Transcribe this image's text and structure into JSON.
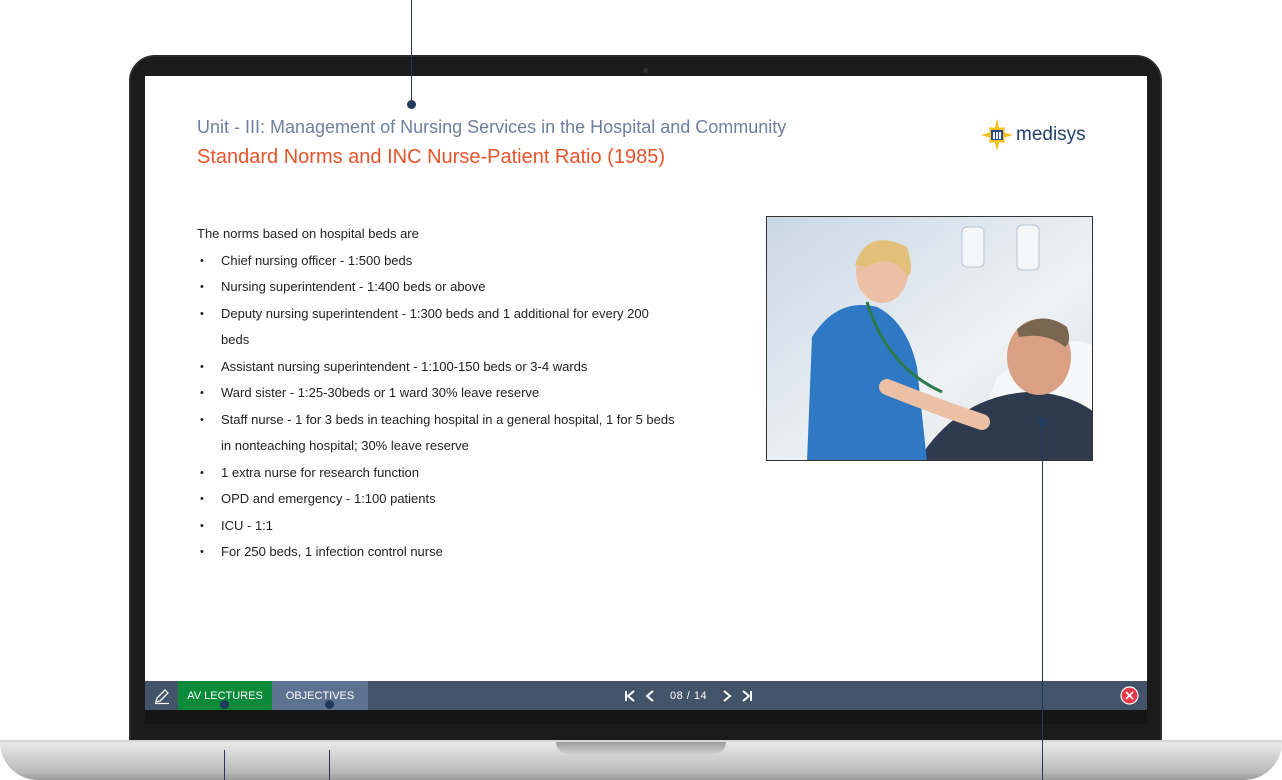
{
  "slide": {
    "unit_title": "Unit - III: Management of Nursing Services in the Hospital and Community",
    "title": "Standard Norms and INC Nurse-Patient Ratio (1985)",
    "logo_text": "medisys",
    "intro": "The norms based on hospital beds are",
    "bullets": [
      "Chief nursing officer - 1:500 beds",
      "Nursing superintendent - 1:400 beds or above",
      "Deputy nursing superintendent - 1:300 beds and 1 additional for every 200",
      "Assistant nursing superintendent - 1:100-150 beds or 3-4 wards",
      "Ward sister - 1:25-30beds or 1 ward 30% leave reserve",
      "Staff nurse - 1 for 3 beds in teaching hospital in a general hospital, 1 for 5 beds",
      "1 extra nurse for research function",
      "OPD and emergency - 1:100 patients",
      "ICU - 1:1",
      "For 250 beds, 1 infection control nurse"
    ],
    "bullet_continuations": {
      "deputy": "beds",
      "staff": "in nonteaching hospital; 30% leave reserve"
    }
  },
  "toolbar": {
    "av_lectures": "AV LECTURES",
    "objectives": "OBJECTIVES",
    "page_indicator": "08 / 14",
    "icons": [
      "pencil-icon",
      "first-page-icon",
      "prev-page-icon",
      "next-page-icon",
      "last-page-icon",
      "close-icon"
    ]
  },
  "colors": {
    "title_orange": "#e8542a",
    "unit_gray_blue": "#6f7fa0",
    "toolbar_bg": "#43536a",
    "av_green": "#0b8a3a",
    "objectives_blue": "#5d7290",
    "close_red": "#e8394a"
  }
}
